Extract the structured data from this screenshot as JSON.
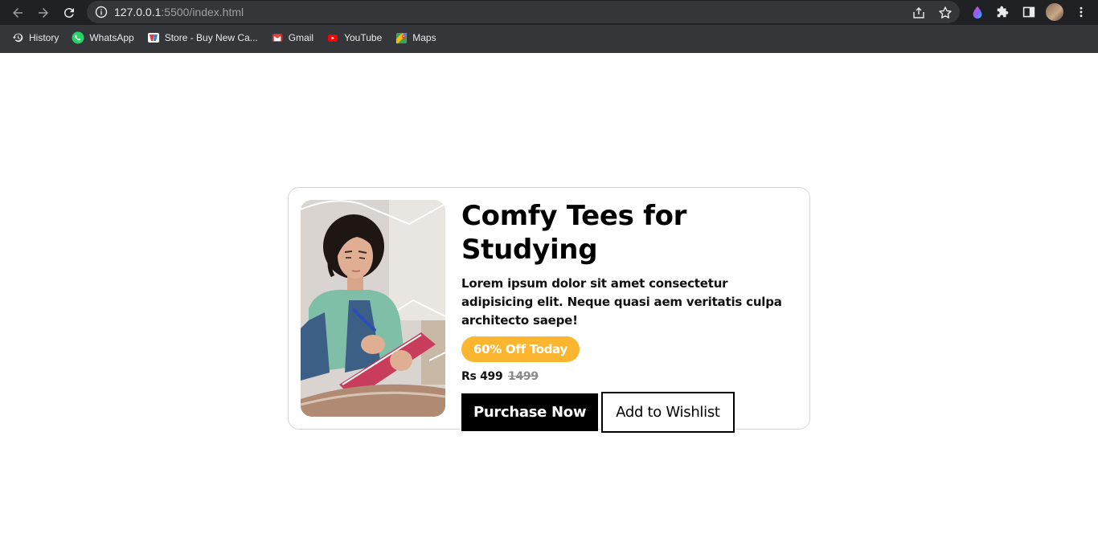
{
  "browser": {
    "url_host": "127.0.0.1",
    "url_path": ":5500/index.html",
    "bookmarks": [
      {
        "label": "History",
        "icon": "history-icon"
      },
      {
        "label": "WhatsApp",
        "icon": "whatsapp-icon"
      },
      {
        "label": "Store - Buy New Ca...",
        "icon": "store-icon"
      },
      {
        "label": "Gmail",
        "icon": "gmail-icon"
      },
      {
        "label": "YouTube",
        "icon": "youtube-icon"
      },
      {
        "label": "Maps",
        "icon": "maps-icon"
      }
    ]
  },
  "card": {
    "title": "Comfy Tees for Studying",
    "description": "Lorem ipsum dolor sit amet consectetur adipisicing elit. Neque quasi aem veritatis culpa architecto saepe!",
    "discount_badge": "60% Off Today",
    "price": "Rs 499",
    "old_price": "1499",
    "purchase_label": "Purchase Now",
    "wishlist_label": "Add to Wishlist"
  },
  "colors": {
    "badge": "#fbb52e",
    "primary_button": "#000000",
    "chrome_toolbar": "#202124",
    "chrome_bookmarks": "#35363a"
  }
}
